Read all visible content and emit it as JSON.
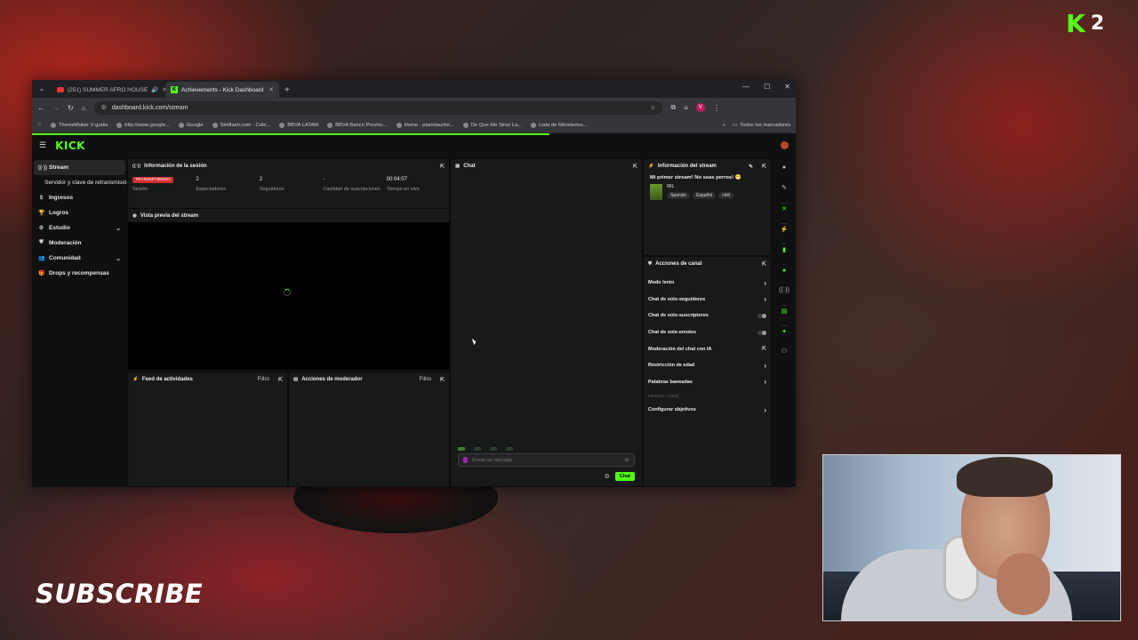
{
  "overlay": {
    "badge_letter": "K",
    "badge_number": "2",
    "subscribe": "SUBSCRIBE"
  },
  "browser": {
    "tabs": [
      {
        "label": "(251) SUMMER AFRO HOUSE",
        "icon": "youtube-icon",
        "active": false
      },
      {
        "label": "Achievements - Kick Dashboard",
        "icon": "kick-icon",
        "active": true
      }
    ],
    "url": "dashboard.kick.com/stream",
    "profile_initial": "V",
    "bookmarks": [
      "ThemeMaker X gratis",
      "http://www.google...",
      "Google",
      "Simflash.com - Cele...",
      "BBVA LATAM",
      "BBVA Banco Provinc...",
      "Home - planetaurbe...",
      "De Que Me Sirve La...",
      "Lista de Ministerios..."
    ],
    "bookmarks_all": "Todos los marcadores"
  },
  "kick": {
    "logo": "KICK",
    "sidebar": [
      {
        "label": "Stream",
        "icon": "stream-icon",
        "active": true
      },
      {
        "label": "Servidor y clave de retransmisión",
        "sub": true
      },
      {
        "label": "Ingresos",
        "icon": "dollar-icon"
      },
      {
        "label": "Logros",
        "icon": "trophy-icon"
      },
      {
        "label": "Estudio",
        "icon": "gear-icon",
        "chevron": true
      },
      {
        "label": "Moderación",
        "icon": "shield-icon"
      },
      {
        "label": "Comunidad",
        "icon": "users-icon",
        "chevron": true
      },
      {
        "label": "Drops y recompensas",
        "icon": "gift-icon"
      }
    ],
    "session": {
      "title": "Información de la sesión",
      "badge": "TRANSMITIENDO",
      "stats": [
        {
          "value": "",
          "label": "Sesión"
        },
        {
          "value": "2",
          "label": "Espectadores"
        },
        {
          "value": "2",
          "label": "Seguidores"
        },
        {
          "value": "-",
          "label": "Cantidad de suscripciones"
        },
        {
          "value": "00:04:07",
          "label": "Tiempo en vivo"
        }
      ]
    },
    "preview": {
      "title": "Vista previa del stream"
    },
    "activity": {
      "title": "Feed de actividades",
      "filter": "Filtro"
    },
    "mod_actions": {
      "title": "Acciones de moderador",
      "filter": "Filtro"
    },
    "chat": {
      "title": "Chat",
      "placeholder": "Enviar un mensaje",
      "send": "Chat"
    },
    "stream_info": {
      "title": "Información del stream",
      "stream_title": "Mi primer stream! No seas perros! 😁",
      "category": "IRL",
      "tags": [
        "Spanish",
        "Español",
        "chill"
      ]
    },
    "channel_actions": {
      "title": "Acciones de canal",
      "items": [
        {
          "label": "Modo lento",
          "control": "arrow"
        },
        {
          "label": "Chat de solo-seguidores",
          "control": "arrow"
        },
        {
          "label": "Chat de solo-suscriptores",
          "control": "toggle"
        },
        {
          "label": "Chat de solo-emotes",
          "control": "toggle"
        },
        {
          "label": "Moderación del chat con IA",
          "control": "external"
        },
        {
          "label": "Restricción de edad",
          "control": "arrow"
        },
        {
          "label": "Palabras baneadas",
          "control": "arrow"
        },
        {
          "label": "Hostear canal",
          "control": "none",
          "disabled": true
        },
        {
          "label": "Configurar objetivos",
          "control": "arrow"
        }
      ]
    }
  }
}
